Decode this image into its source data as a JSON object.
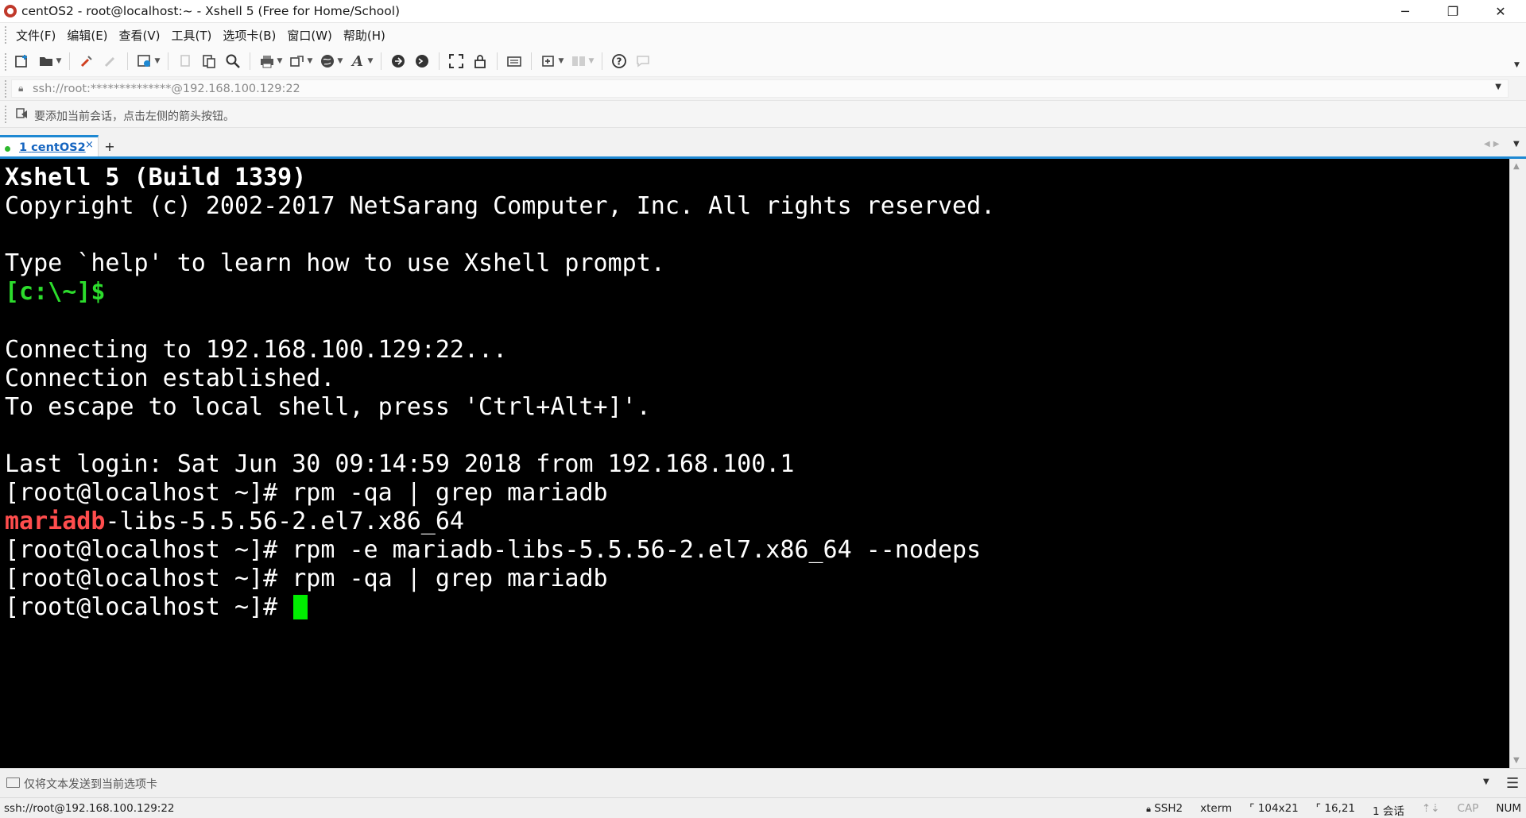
{
  "window": {
    "title": "centOS2 - root@localhost:~ - Xshell 5 (Free for Home/School)",
    "minimize": "─",
    "restore": "❐",
    "close": "✕"
  },
  "menu": [
    "文件(F)",
    "编辑(E)",
    "查看(V)",
    "工具(T)",
    "选项卡(B)",
    "窗口(W)",
    "帮助(H)"
  ],
  "toolbar": {
    "icons": [
      "new-session-icon",
      "open-folder-icon",
      "reconnect-icon",
      "disconnect-icon",
      "properties-icon",
      "copy-icon",
      "paste-icon",
      "find-icon",
      "print-icon",
      "transfer-icon",
      "globe-icon",
      "font-icon",
      "xftp-icon",
      "xshell-icon",
      "fullscreen-icon",
      "lock-icon",
      "keyboard-icon",
      "compose-icon",
      "layout-icon",
      "help-icon",
      "chat-icon"
    ]
  },
  "address": {
    "value": "ssh://root:**************@192.168.100.129:22"
  },
  "hint": {
    "text": "要添加当前会话，点击左侧的箭头按钮。"
  },
  "tabs": [
    {
      "number": "1",
      "label": "centOS2",
      "active": true,
      "status_color": "#2eb82e"
    }
  ],
  "terminal": {
    "background": "#000000",
    "lines": [
      [
        {
          "t": "Xshell 5 (Build 1339)",
          "s": "b"
        }
      ],
      [
        {
          "t": "Copyright (c) 2002-2017 NetSarang Computer, Inc. All rights reserved.",
          "s": ""
        }
      ],
      [],
      [
        {
          "t": "Type `help' to learn how to use Xshell prompt.",
          "s": ""
        }
      ],
      [
        {
          "t": "[c:\\~]$",
          "s": "g"
        }
      ],
      [],
      [
        {
          "t": "Connecting to 192.168.100.129:22...",
          "s": ""
        }
      ],
      [
        {
          "t": "Connection established.",
          "s": ""
        }
      ],
      [
        {
          "t": "To escape to local shell, press 'Ctrl+Alt+]'.",
          "s": ""
        }
      ],
      [],
      [
        {
          "t": "Last login: Sat Jun 30 09:14:59 2018 from 192.168.100.1",
          "s": ""
        }
      ],
      [
        {
          "t": "[root@localhost ~]# rpm -qa | grep mariadb",
          "s": ""
        }
      ],
      [
        {
          "t": "mariadb",
          "s": "r"
        },
        {
          "t": "-libs-5.5.56-2.el7.x86_64",
          "s": ""
        }
      ],
      [
        {
          "t": "[root@localhost ~]# rpm -e mariadb-libs-5.5.56-2.el7.x86_64 --nodeps",
          "s": ""
        }
      ],
      [
        {
          "t": "[root@localhost ~]# rpm -qa | grep mariadb",
          "s": ""
        }
      ],
      [
        {
          "t": "[root@localhost ~]# ",
          "s": ""
        }
      ]
    ]
  },
  "compose": {
    "text": "仅将文本发送到当前选项卡"
  },
  "status": {
    "connection": "ssh://root@192.168.100.129:22",
    "protocol": "SSH2",
    "terminal_type": "xterm",
    "size": "104x21",
    "cursor_pos": "16,21",
    "sessions": "1 会话",
    "caps": "CAP",
    "num": "NUM"
  }
}
